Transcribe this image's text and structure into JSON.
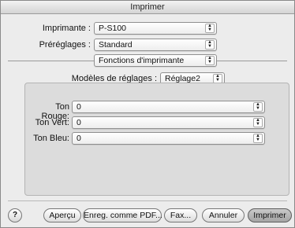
{
  "window": {
    "title": "Imprimer"
  },
  "form": {
    "printer_label": "Imprimante :",
    "printer_value": "P-S100",
    "presets_label": "Préréglages :",
    "presets_value": "Standard",
    "section_value": "Fonctions d'imprimante",
    "settings_model_label": "Modèles de réglages :",
    "settings_model_value": "Réglage2"
  },
  "tones": [
    {
      "label": "Ton Rouge:",
      "value": "0"
    },
    {
      "label": "Ton Vert:",
      "value": "0"
    },
    {
      "label": "Ton Bleu:",
      "value": "0"
    }
  ],
  "buttons": {
    "help": "?",
    "preview": "Aperçu",
    "save_pdf": "Enreg. comme PDF...",
    "fax": "Fax...",
    "cancel": "Annuler",
    "print": "Imprimer"
  }
}
